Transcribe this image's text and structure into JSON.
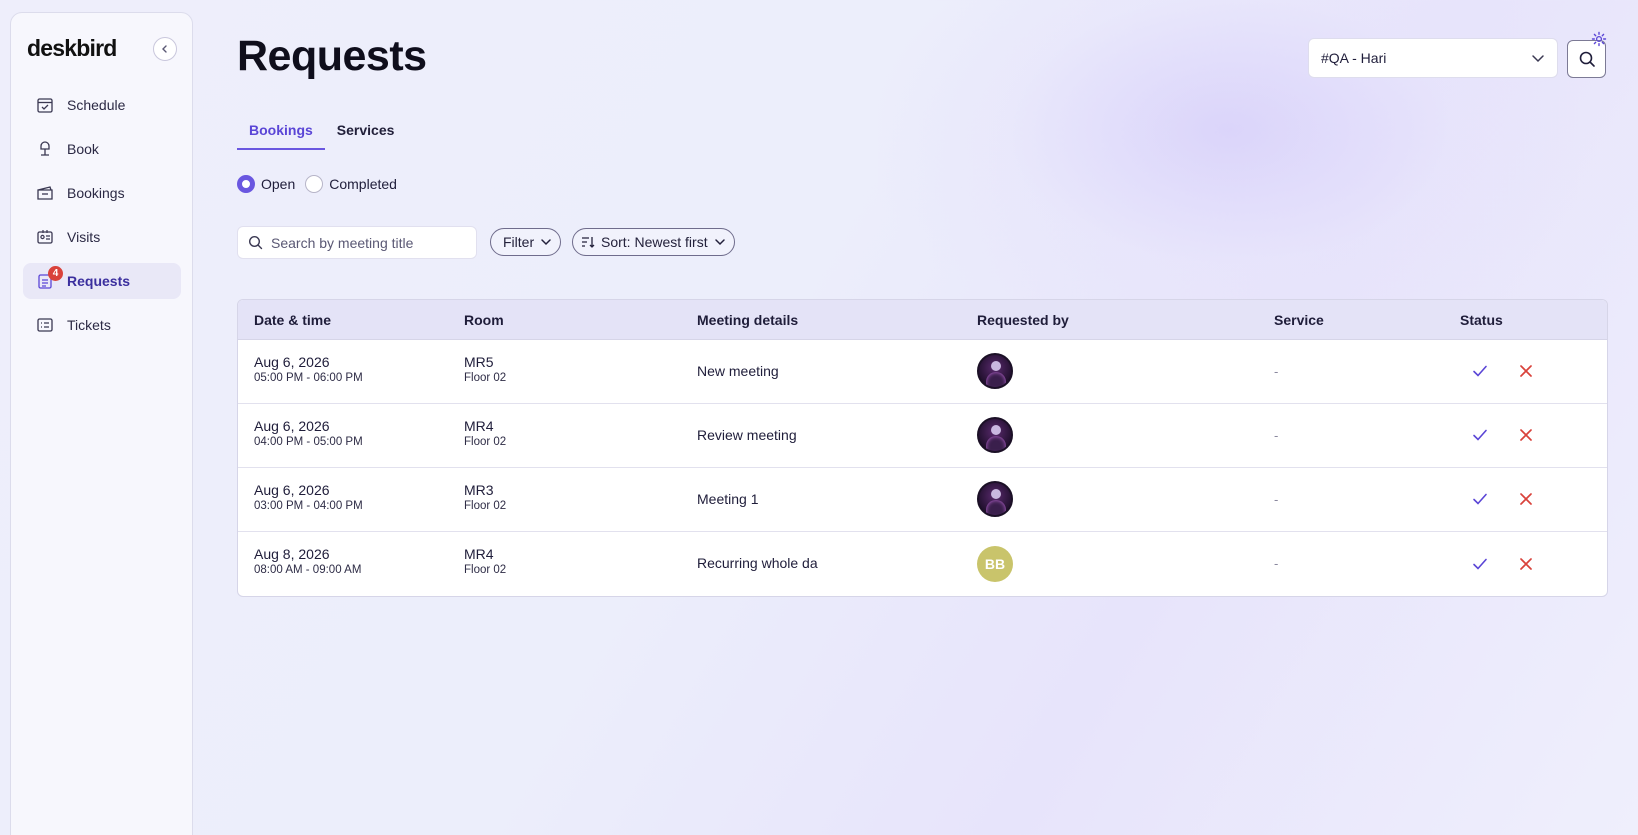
{
  "sidebar": {
    "logo": "deskbird",
    "items": [
      {
        "label": "Schedule",
        "icon": "calendar-check-icon"
      },
      {
        "label": "Book",
        "icon": "desk-lamp-icon"
      },
      {
        "label": "Bookings",
        "icon": "ticket-icon"
      },
      {
        "label": "Visits",
        "icon": "id-card-icon"
      },
      {
        "label": "Requests",
        "icon": "clipboard-icon",
        "badge": "4",
        "active": true
      },
      {
        "label": "Tickets",
        "icon": "list-icon"
      }
    ]
  },
  "header": {
    "title": "Requests",
    "office_select": "#QA - Hari"
  },
  "tabs": [
    {
      "label": "Bookings",
      "active": true
    },
    {
      "label": "Services",
      "active": false
    }
  ],
  "status_filter": {
    "open_label": "Open",
    "completed_label": "Completed",
    "selected": "Open"
  },
  "toolbar": {
    "search_placeholder": "Search by meeting title",
    "filter_label": "Filter",
    "sort_label": "Sort: Newest first"
  },
  "table": {
    "headers": [
      "Date & time",
      "Room",
      "Meeting details",
      "Requested by",
      "Service",
      "Status"
    ],
    "rows": [
      {
        "date": "Aug 6, 2026",
        "time": "05:00 PM - 06:00 PM",
        "room": "MR5",
        "floor": "Floor 02",
        "meeting": "New meeting",
        "requester": "avatar",
        "service": "-"
      },
      {
        "date": "Aug 6, 2026",
        "time": "04:00 PM - 05:00 PM",
        "room": "MR4",
        "floor": "Floor 02",
        "meeting": "Review meeting",
        "requester": "avatar",
        "service": "-"
      },
      {
        "date": "Aug 6, 2026",
        "time": "03:00 PM - 04:00 PM",
        "room": "MR3",
        "floor": "Floor 02",
        "meeting": "Meeting 1",
        "requester": "avatar",
        "service": "-"
      },
      {
        "date": "Aug 8, 2026",
        "time": "08:00 AM - 09:00 AM",
        "room": "MR4",
        "floor": "Floor 02",
        "meeting": "Recurring whole da",
        "requester": "BB",
        "service": "-"
      }
    ]
  },
  "colors": {
    "accent": "#6a57e0",
    "approve": "#5a45d6",
    "reject": "#d9423b",
    "badge": "#d9423b"
  }
}
